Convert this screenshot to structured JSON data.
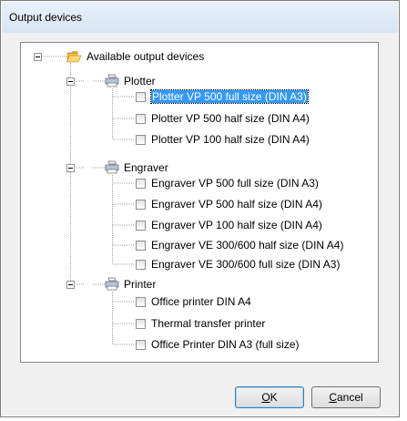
{
  "window": {
    "title": "Output devices"
  },
  "tree": {
    "root_label": "Available output devices",
    "groups": [
      {
        "label": "Plotter",
        "items": [
          "Plotter VP 500 full size (DIN A3)",
          "Plotter VP 500 half size (DIN A4)",
          "Plotter VP 100 half size (DIN A4)"
        ]
      },
      {
        "label": "Engraver",
        "items": [
          "Engraver VP 500 full size (DIN A3)",
          "Engraver VP 500 half size (DIN A4)",
          "Engraver VP 100 half size (DIN A4)",
          "Engraver VE 300/600 half size (DIN A4)",
          "Engraver VE 300/600 full size (DIN A3)"
        ]
      },
      {
        "label": "Printer",
        "items": [
          "Office printer DIN A4",
          "Thermal transfer printer",
          "Office Printer DIN A3 (full size)"
        ]
      }
    ],
    "selected_item": "Plotter VP 500 full size (DIN A3)"
  },
  "buttons": {
    "ok_mnemonic": "O",
    "ok_rest": "K",
    "cancel_mnemonic": "C",
    "cancel_rest": "ancel"
  }
}
